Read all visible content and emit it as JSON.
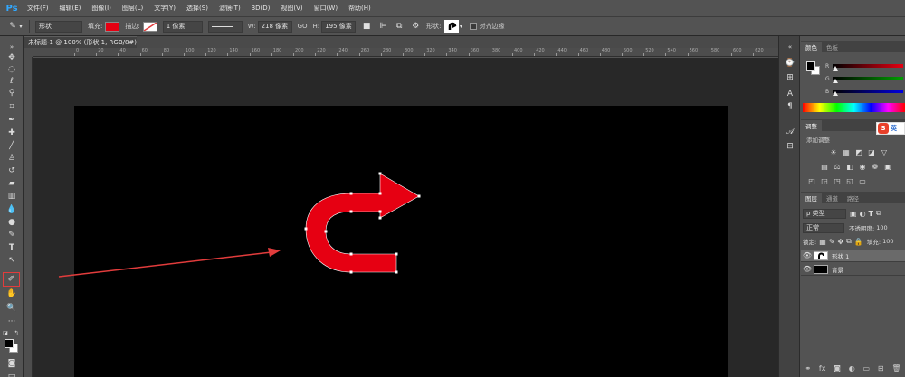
{
  "app": {
    "logo": "Ps"
  },
  "menu": [
    "文件(F)",
    "编辑(E)",
    "图像(I)",
    "图层(L)",
    "文字(Y)",
    "选择(S)",
    "滤镜(T)",
    "3D(D)",
    "视图(V)",
    "窗口(W)",
    "帮助(H)"
  ],
  "options": {
    "mode": "形状",
    "fill_label": "填充:",
    "fill_color": "#e60012",
    "stroke_label": "描边:",
    "stroke_width": "1 像素",
    "w_label": "W:",
    "w_value": "218 像素",
    "link_icon": "GO",
    "h_label": "H:",
    "h_value": "195 像素",
    "shape_label": "形状:",
    "align_edges_label": "对齐边缘"
  },
  "document": {
    "tab_title": "未标题-1 @ 100% (形状 1, RGB/8#) *",
    "canvas_color": "#000000",
    "pasteboard_color": "#282828",
    "ruler_numbers": [
      "0",
      "20",
      "40",
      "60",
      "80",
      "100",
      "120",
      "140",
      "160",
      "180",
      "200",
      "220",
      "240",
      "260",
      "280",
      "300",
      "320",
      "340",
      "360",
      "380",
      "400",
      "420",
      "440",
      "460",
      "480",
      "500",
      "520",
      "540",
      "560",
      "580",
      "600",
      "620"
    ]
  },
  "shape": {
    "color": "#e60012",
    "handle_color": "#ffffff"
  },
  "annotation": {
    "arrow_color": "#e23c3c"
  },
  "panels": {
    "color": {
      "tabs": [
        "颜色",
        "色板"
      ],
      "sliders": [
        {
          "label": "R",
          "color": "#e60012"
        },
        {
          "label": "G",
          "color": "#00a000"
        },
        {
          "label": "B",
          "color": "#0000e0"
        }
      ]
    },
    "adjustments": {
      "tab": "调整",
      "add_label": "添加调整"
    },
    "layers": {
      "tabs": [
        "图层",
        "通道",
        "路径"
      ],
      "kind_label": "ρ 类型",
      "blend_mode": "正常",
      "opacity_label": "不透明度:",
      "opacity_value": "100",
      "lock_label": "锁定:",
      "fill_label": "填充:",
      "fill_value": "100",
      "items": [
        {
          "name": "形状 1",
          "selected": true
        },
        {
          "name": "背景",
          "selected": false
        }
      ]
    },
    "ime": {
      "s": "S",
      "lang": "英"
    }
  }
}
